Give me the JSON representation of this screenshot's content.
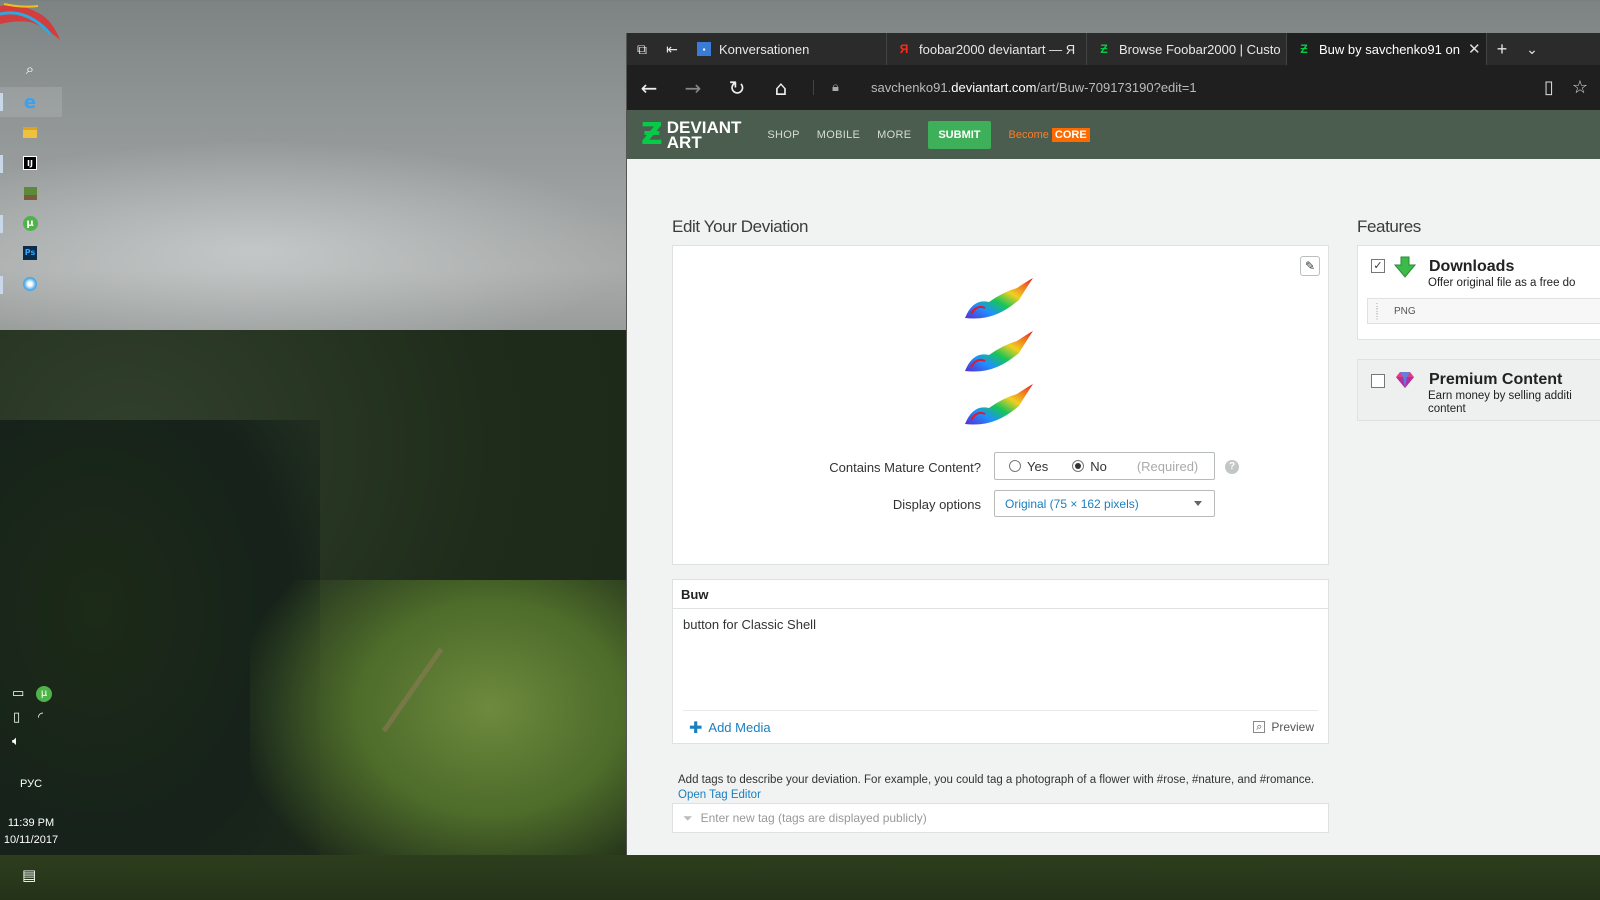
{
  "taskbar": {
    "icons": [
      "search-icon",
      "edge-icon",
      "file-explorer-icon",
      "intellij-icon",
      "minecraft-icon",
      "utorrent-icon",
      "photoshop-icon",
      "globe-icon"
    ],
    "lang": "РУС",
    "time": "11:39 PM",
    "date": "10/11/2017"
  },
  "browser": {
    "tabs": [
      {
        "label": "Konversationen",
        "fav": "chat-favicon"
      },
      {
        "label": "foobar2000 deviantart — Я",
        "fav": "yandex-favicon"
      },
      {
        "label": "Browse Foobar2000 | Custo",
        "fav": "deviantart-favicon"
      },
      {
        "label": "Buw by savchenko91 on",
        "fav": "deviantart-favicon",
        "active": true
      }
    ],
    "url_prefix": "savchenko91.",
    "url_domain": "deviantart.com",
    "url_path": "/art/Buw-709173190?edit=1"
  },
  "da": {
    "logo_line1": "DEVIANT",
    "logo_line2": "ART",
    "nav": [
      "SHOP",
      "MOBILE",
      "MORE"
    ],
    "submit": "SUBMIT",
    "become": "Become",
    "core": "CORE",
    "accent_color": "#05cc47"
  },
  "edit": {
    "title": "Edit Your Deviation",
    "mature_label": "Contains Mature Content?",
    "yes": "Yes",
    "no": "No",
    "required": "(Required)",
    "mature_selected": "No",
    "display_label": "Display options",
    "display_value": "Original (75 × 162 pixels)",
    "deviation_title": "Buw",
    "description": "button for Classic Shell",
    "add_media": "Add Media",
    "preview": "Preview",
    "tags_help": "Add tags to describe your deviation. For example, you could tag a photograph of a flower with #rose, #nature, and #romance.",
    "open_tag_editor": "Open Tag Editor",
    "tag_placeholder": "Enter new tag (tags are displayed publicly)"
  },
  "features": {
    "title": "Features",
    "downloads_name": "Downloads",
    "downloads_desc": "Offer original file as a free do",
    "downloads_checked": true,
    "file_type": "PNG",
    "premium_name": "Premium Content",
    "premium_desc1": "Earn money by selling additi",
    "premium_desc2": "content",
    "premium_checked": false
  }
}
